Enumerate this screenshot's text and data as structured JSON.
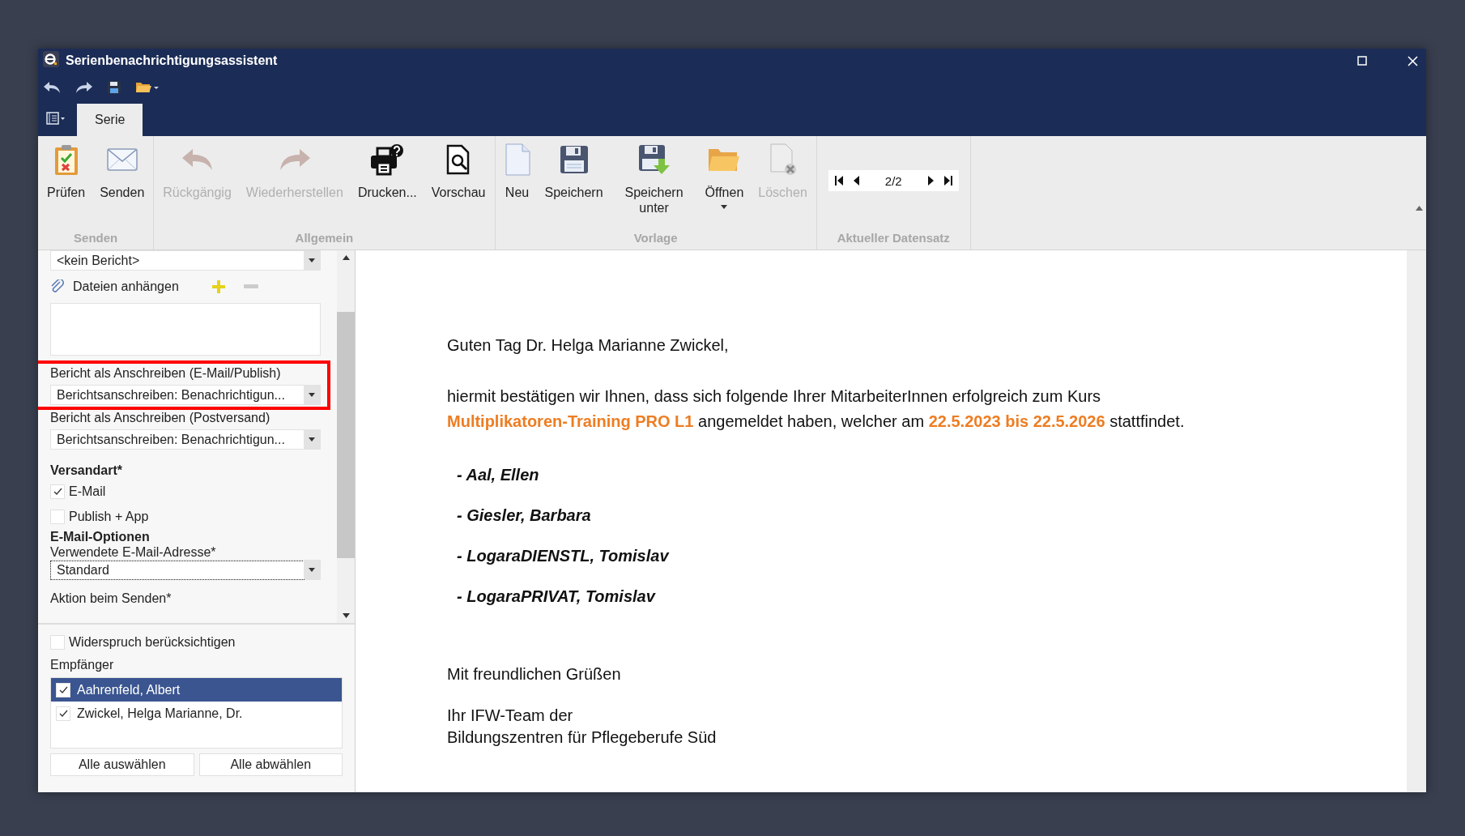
{
  "window": {
    "title": "Serienbenachrichtigungsassistent"
  },
  "tabs": [
    {
      "label": "Serie",
      "selected": true
    }
  ],
  "ribbon": {
    "groups": [
      {
        "label": "Senden",
        "buttons": [
          {
            "label": "Prüfen",
            "disabled": false,
            "dropdown": false
          },
          {
            "label": "Senden",
            "disabled": false,
            "dropdown": false
          }
        ]
      },
      {
        "label": "Allgemein",
        "buttons": [
          {
            "label": "Rückgängig",
            "disabled": true,
            "dropdown": false
          },
          {
            "label": "Wiederherstellen",
            "disabled": true,
            "dropdown": false
          },
          {
            "label": "Drucken...",
            "disabled": false,
            "dropdown": false
          },
          {
            "label": "Vorschau",
            "disabled": false,
            "dropdown": false
          }
        ]
      },
      {
        "label": "Vorlage",
        "buttons": [
          {
            "label": "Neu",
            "disabled": false,
            "dropdown": false
          },
          {
            "label": "Speichern",
            "disabled": false,
            "dropdown": false
          },
          {
            "label": "Speichern unter",
            "disabled": false,
            "dropdown": false
          },
          {
            "label": "Öffnen",
            "disabled": false,
            "dropdown": true
          },
          {
            "label": "Löschen",
            "disabled": true,
            "dropdown": false
          }
        ]
      },
      {
        "label": "Aktueller Datensatz",
        "record": "2/2"
      }
    ]
  },
  "settings": {
    "report_select": {
      "value": "<kein Bericht>"
    },
    "attachments": {
      "label": "Dateien anhängen"
    },
    "fields": [
      {
        "label": "Bericht als Anschreiben (E-Mail/Publish)",
        "value": "Berichtsanschreiben: Benachrichtigun...",
        "highlighted": true
      },
      {
        "label": "Bericht als Anschreiben (Postversand)",
        "value": "Berichtsanschreiben: Benachrichtigun...",
        "highlighted": false
      }
    ],
    "shipping": {
      "heading": "Versandart*",
      "options": [
        {
          "label": "E-Mail",
          "checked": true
        },
        {
          "label": "Publish + App",
          "checked": false
        }
      ]
    },
    "email_options": {
      "heading": "E-Mail-Optionen",
      "address_label": "Verwendete E-Mail-Adresse*",
      "address_value": "Standard",
      "action_label": "Aktion beim Senden*"
    }
  },
  "recipients": {
    "objection": {
      "label": "Widerspruch berücksichtigen",
      "checked": false
    },
    "heading": "Empfänger",
    "items": [
      {
        "name": "Aahrenfeld, Albert",
        "checked": true,
        "selected": true
      },
      {
        "name": "Zwickel, Helga Marianne, Dr.",
        "checked": true,
        "selected": false
      }
    ],
    "buttons": [
      "Alle auswählen",
      "Alle abwählen"
    ]
  },
  "document": {
    "greeting": "Guten Tag Dr. Helga Marianne Zwickel,",
    "intro_lines": [
      "hiermit bestätigen wir Ihnen, dass sich folgende Ihrer MitarbeiterInnen erfolgreich zum Kurs",
      "**Multiplikatoren-Training PRO L1**  angemeldet haben, welcher am **22.5.2023 bis 22.5.2026** stattfindet."
    ],
    "participants": [
      "- Aal, Ellen",
      "- Giesler, Barbara",
      "- LogaraDIENSTL, Tomislav",
      "- LogaraPRIVAT, Tomislav"
    ],
    "closing": "Mit freundlichen Grüßen",
    "signature": [
      "Ihr IFW-Team der",
      "Bildungszentren für Pflegeberufe Süd"
    ]
  }
}
